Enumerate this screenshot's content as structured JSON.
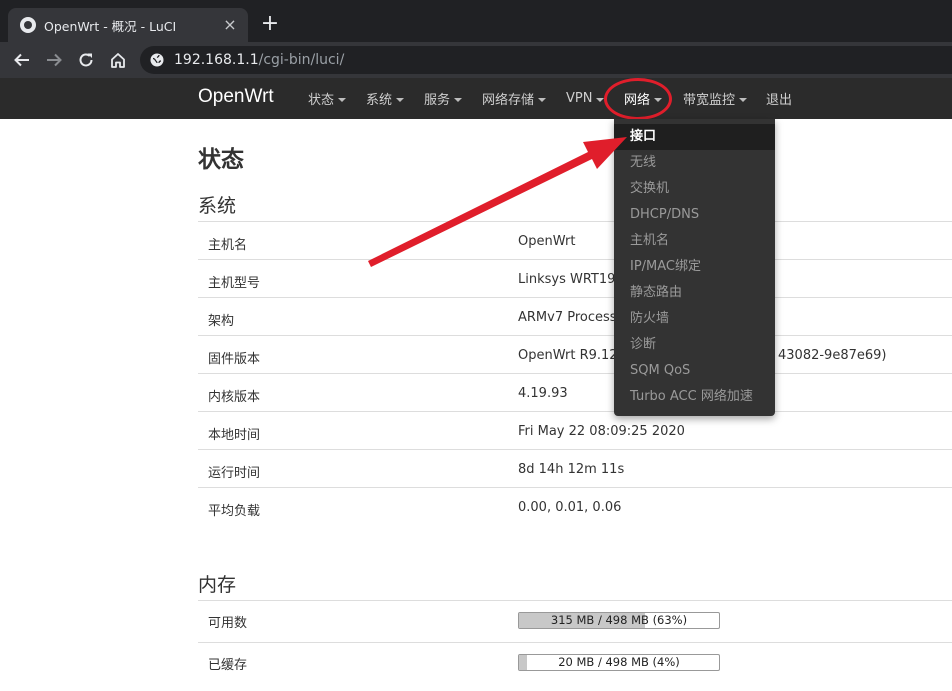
{
  "browser": {
    "tab_title": "OpenWrt - 概况 - LuCI",
    "tab_close": "×",
    "new_tab": "+",
    "url_host": "192.168.1.1",
    "url_path": "/cgi-bin/luci/"
  },
  "navbar": {
    "brand": "OpenWrt",
    "menus": [
      "状态",
      "系统",
      "服务",
      "网络存储",
      "VPN",
      "网络",
      "带宽监控",
      "退出"
    ],
    "active_menu": "网络"
  },
  "dropdown": {
    "items": [
      "接口",
      "无线",
      "交换机",
      "DHCP/DNS",
      "主机名",
      "IP/MAC绑定",
      "静态路由",
      "防火墙",
      "诊断",
      "SQM QoS",
      "Turbo ACC 网络加速"
    ],
    "selected": "接口"
  },
  "page": {
    "title": "状态",
    "system": {
      "title": "系统",
      "rows": [
        {
          "label": "主机名",
          "value": "OpenWrt"
        },
        {
          "label": "主机型号",
          "value": "Linksys WRT190"
        },
        {
          "label": "架构",
          "value": "ARMv7 Processo"
        },
        {
          "label": "固件版本",
          "value": "OpenWrt R9.12.3"
        },
        {
          "label": "内核版本",
          "value": "4.19.93"
        },
        {
          "label": "本地时间",
          "value": "Fri May 22 08:09:25 2020"
        },
        {
          "label": "运行时间",
          "value": "8d 14h 12m 11s"
        },
        {
          "label": "平均负载",
          "value": "0.00, 0.01, 0.06"
        }
      ],
      "firmware_suffix": "43082-9e87e69)"
    },
    "memory": {
      "title": "内存",
      "rows": [
        {
          "label": "可用数",
          "text": "315 MB / 498 MB (63%)",
          "fraction": 0.63
        },
        {
          "label": "已缓存",
          "text": "20 MB / 498 MB (4%)",
          "fraction": 0.04
        }
      ]
    }
  },
  "colors": {
    "annotation_red": "#e01e2b",
    "navbar_bg": "#2b2b2b",
    "dropdown_bg": "#333333"
  },
  "icons": [
    "favicon-icon",
    "back-arrow-icon",
    "forward-arrow-icon",
    "reload-icon",
    "home-icon",
    "globe-icon",
    "caret-down-icon"
  ]
}
